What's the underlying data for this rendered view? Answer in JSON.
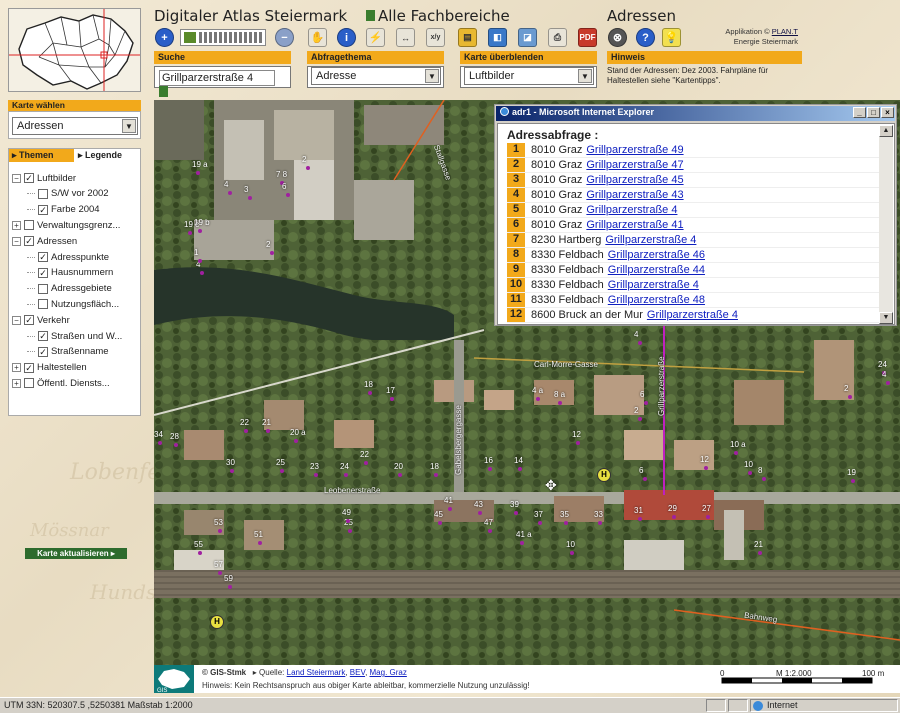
{
  "header": {
    "title_main": "Digitaler Atlas Steiermark",
    "title_fach": "Alle Fachbereiche",
    "title_adressen": "Adressen",
    "applikation_prefix": "Applikation ©",
    "applikation_link": "PLAN.T",
    "applikation_sub": "Energie Steiermark"
  },
  "search": {
    "label": "Suche",
    "value": "Grillparzerstraße 4"
  },
  "abfrage": {
    "label": "Abfragethema",
    "selected": "Adresse"
  },
  "overlay": {
    "label": "Karte überblenden",
    "selected": "Luftbilder"
  },
  "hinweis": {
    "label": "Hinweis",
    "text": "Stand der Adressen: Dez 2003. Fahrpläne für Haltestellen siehe \"Kartentipps\"."
  },
  "karte_waehlen": {
    "label": "Karte wählen",
    "selected": "Adressen"
  },
  "layers": {
    "tab_themen": "Themen",
    "tab_legende": "Legende",
    "items": [
      {
        "label": "Luftbilder",
        "indent": 0,
        "pm": "−",
        "checked": true
      },
      {
        "label": "S/W vor 2002",
        "indent": 1,
        "pm": "",
        "checked": false
      },
      {
        "label": "Farbe 2004",
        "indent": 1,
        "pm": "",
        "checked": true
      },
      {
        "label": "Verwaltungsgrenz...",
        "indent": 0,
        "pm": "+",
        "checked": false
      },
      {
        "label": "Adressen",
        "indent": 0,
        "pm": "−",
        "checked": true
      },
      {
        "label": "Adresspunkte",
        "indent": 1,
        "pm": "",
        "checked": true
      },
      {
        "label": "Hausnummern",
        "indent": 1,
        "pm": "",
        "checked": true
      },
      {
        "label": "Adressgebiete",
        "indent": 1,
        "pm": "",
        "checked": false
      },
      {
        "label": "Nutzungsfläch...",
        "indent": 1,
        "pm": "",
        "checked": false
      },
      {
        "label": "Verkehr",
        "indent": 0,
        "pm": "−",
        "checked": true
      },
      {
        "label": "Straßen und W...",
        "indent": 1,
        "pm": "",
        "checked": true
      },
      {
        "label": "Straßenname",
        "indent": 1,
        "pm": "",
        "checked": true
      },
      {
        "label": "Haltestellen",
        "indent": 0,
        "pm": "+",
        "checked": true
      },
      {
        "label": "Öffentl. Diensts...",
        "indent": 0,
        "pm": "+",
        "checked": false
      }
    ],
    "update_button": "Karte aktualisieren"
  },
  "popup": {
    "window_title": "adr1 - Microsoft Internet Explorer",
    "heading": "Adressabfrage :",
    "rows": [
      {
        "n": "1",
        "city": "8010 Graz",
        "street": "Grillparzerstraße  49"
      },
      {
        "n": "2",
        "city": "8010 Graz",
        "street": "Grillparzerstraße  47"
      },
      {
        "n": "3",
        "city": "8010 Graz",
        "street": "Grillparzerstraße  45"
      },
      {
        "n": "4",
        "city": "8010 Graz",
        "street": "Grillparzerstraße  43"
      },
      {
        "n": "5",
        "city": "8010 Graz",
        "street": "Grillparzerstraße  4"
      },
      {
        "n": "6",
        "city": "8010 Graz",
        "street": "Grillparzerstraße  41"
      },
      {
        "n": "7",
        "city": "8230 Hartberg",
        "street": "Grillparzerstraße  4"
      },
      {
        "n": "8",
        "city": "8330 Feldbach",
        "street": "Grillparzerstraße  46"
      },
      {
        "n": "9",
        "city": "8330 Feldbach",
        "street": "Grillparzerstraße  44"
      },
      {
        "n": "10",
        "city": "8330 Feldbach",
        "street": "Grillparzerstraße  4"
      },
      {
        "n": "11",
        "city": "8330 Feldbach",
        "street": "Grillparzerstraße  48"
      },
      {
        "n": "12",
        "city": "8600 Bruck an der Mur",
        "street": "Grillparzerstraße  4"
      }
    ]
  },
  "map": {
    "streets": [
      "Carl-Morre-Gasse",
      "Leobenerstraße",
      "Gabelsbergergasse",
      "Grillparzerstraße",
      "Bahnweg",
      "Stallgasse"
    ],
    "housenumbers": [
      "19 a",
      "4",
      "3",
      "7 8",
      "6",
      "19 b",
      "19 c",
      "2",
      "4",
      "1",
      "2",
      "18",
      "17",
      "22",
      "21",
      "20 a",
      "34",
      "28",
      "30",
      "25",
      "23",
      "24",
      "22",
      "20",
      "18",
      "16",
      "14",
      "12",
      "10 a",
      "10",
      "8",
      "6",
      "4",
      "2",
      "41",
      "43",
      "45",
      "47",
      "39",
      "37",
      "35",
      "33",
      "31",
      "29",
      "27",
      "25",
      "51",
      "53",
      "55",
      "57",
      "59",
      "41 a",
      "49",
      "8 a",
      "4 a",
      "21",
      "24",
      "19",
      "6",
      "2",
      "4",
      "10",
      "12"
    ]
  },
  "footer": {
    "copyright": "© GIS-Stmk",
    "quelle_prefix": "Quelle:",
    "quelle_links": [
      "Land Steiermark",
      "BEV",
      "Mag. Graz"
    ],
    "hinweis": "Hinweis: Kein Rechtsanspruch aus obiger Karte ableitbar, kommerzielle Nutzung unzulässig!",
    "scale_label": "M 1:2.000",
    "scale_unit": "100 m",
    "scale_zero": "0"
  },
  "status": {
    "coords": "UTM 33N: 520307.5 ,5250381 Maßstab 1:2000",
    "zone": "Internet"
  }
}
